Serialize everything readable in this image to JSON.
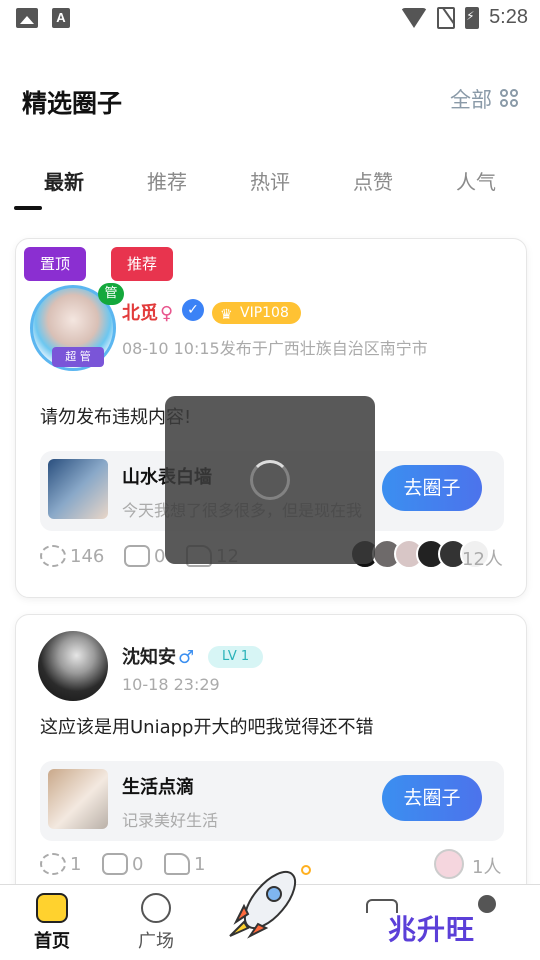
{
  "status_bar": {
    "time": "5:28"
  },
  "header": {
    "title": "精选圈子",
    "all_label": "全部"
  },
  "tabs": [
    {
      "label": "最新"
    },
    {
      "label": "推荐"
    },
    {
      "label": "热评"
    },
    {
      "label": "点赞"
    },
    {
      "label": "人气"
    }
  ],
  "posts": [
    {
      "badges": [
        "置顶",
        "推荐"
      ],
      "author": "北觅",
      "gender": "♀",
      "admin_tag": "管",
      "frame_tag": "超 管",
      "vip": "VIP108",
      "meta": "08-10 10:15发布于广西壮族自治区南宁市",
      "content": "请勿发布违规内容!",
      "circle": {
        "name": "山水表白墙",
        "desc": "今天我想了很多很多，但是现在我",
        "button": "去圈子"
      },
      "stats": {
        "views": "146",
        "comments": "0",
        "likes": "12"
      },
      "members_count": "12人"
    },
    {
      "author": "沈知安",
      "gender": "♂",
      "level": "LV 1",
      "meta": "10-18 23:29",
      "content": "这应该是用Uniapp开大的吧我觉得还不错",
      "circle": {
        "name": "生活点滴",
        "desc": "记录美好生活",
        "button": "去圈子"
      },
      "stats": {
        "views": "1",
        "comments": "0",
        "likes": "1"
      },
      "members_count": "1人"
    }
  ],
  "tabbar": {
    "home": "首页",
    "square": "广场",
    "brand": "兆升旺"
  },
  "colors": {
    "accent": "#3b8ff0",
    "badge_pin": "#8b2fd1",
    "badge_rec": "#e8344e",
    "name_red": "#e23b3b",
    "vip": "#ffc233"
  }
}
